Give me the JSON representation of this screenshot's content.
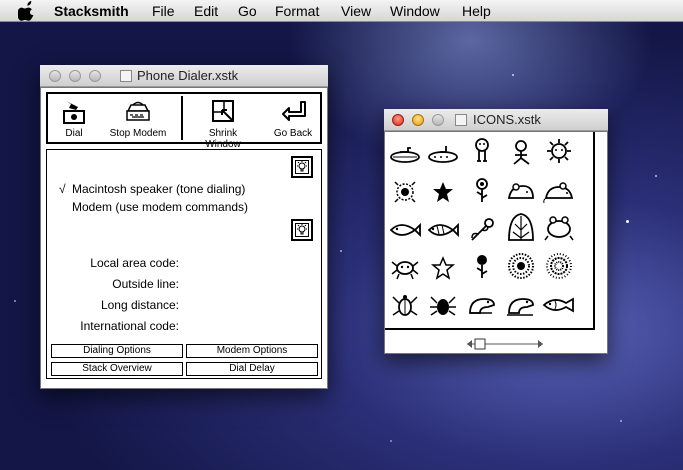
{
  "menubar": {
    "app_name": "Stacksmith",
    "items": [
      "File",
      "Edit",
      "Go",
      "Format",
      "View",
      "Window",
      "Help"
    ]
  },
  "phone_dialer": {
    "title": "Phone Dialer.xstk",
    "toolbar": {
      "dial": "Dial",
      "stop_modem": "Stop Modem",
      "shrink_window": "Shrink Window",
      "go_back": "Go Back"
    },
    "options": {
      "checkmark": "√",
      "speaker": "Macintosh speaker (tone dialing)",
      "modem": "Modem (use modem commands)"
    },
    "fields": {
      "local_area_code": "Local area code:",
      "outside_line": "Outside line:",
      "long_distance": "Long distance:",
      "international_code": "International code:"
    },
    "buttons": {
      "dialing_options": "Dialing Options",
      "modem_options": "Modem Options",
      "stack_overview": "Stack Overview",
      "dial_delay": "Dial Delay"
    }
  },
  "icons_window": {
    "title": "ICONS.xstk",
    "icons": [
      "sub-icon",
      "sub-icon",
      "ghost-icon",
      "ghost-icon",
      "sun-icon",
      "splat-icon",
      "star-icon",
      "flower-icon",
      "mouse-icon",
      "mouse-icon",
      "fish-icon",
      "fish-icon",
      "rose-icon",
      "leaf-icon",
      "frog-icon",
      "spider-icon",
      "star-icon",
      "flower-icon",
      "fuzz-icon",
      "fuzz-icon",
      "bug-icon",
      "bug-icon",
      "lizard-icon",
      "lizard-icon",
      "fish-icon"
    ]
  }
}
